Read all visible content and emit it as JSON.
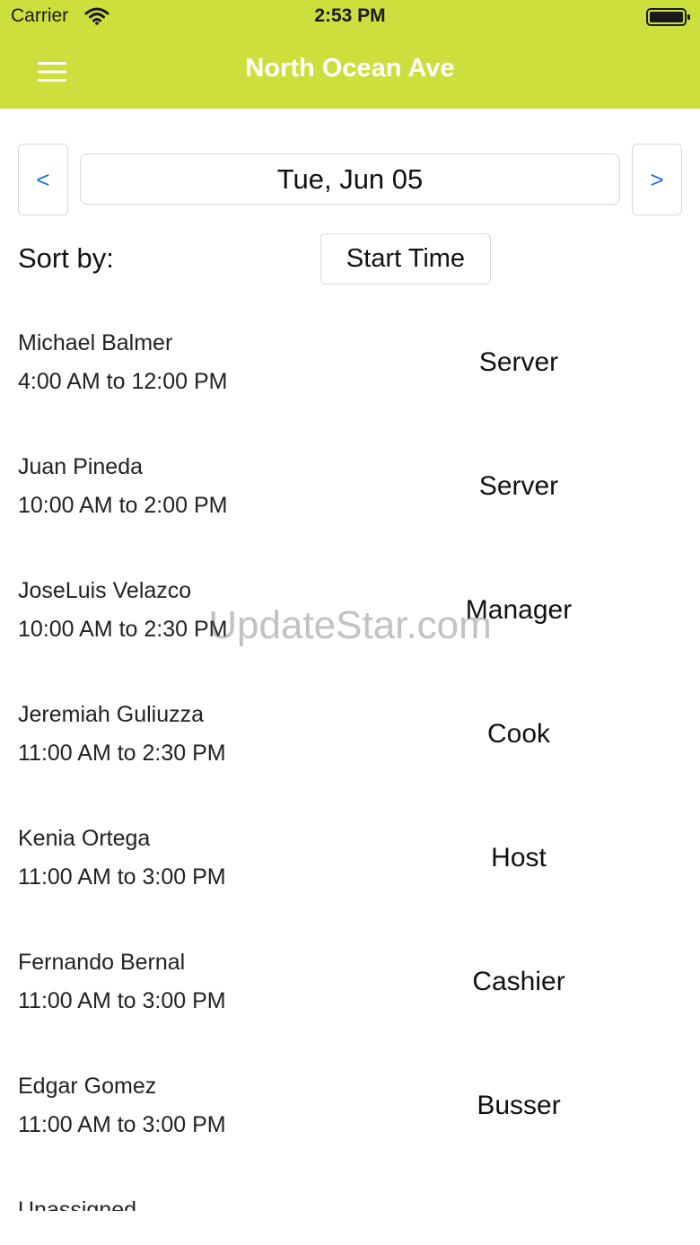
{
  "status_bar": {
    "carrier": "Carrier",
    "time": "2:53 PM",
    "icons": [
      "wifi-icon",
      "battery-icon"
    ]
  },
  "nav": {
    "title": "North Ocean Ave",
    "menu_icon": "menu-icon",
    "bar_color": "#cddf3c"
  },
  "date_nav": {
    "prev_label": "<",
    "next_label": ">",
    "date": "Tue, Jun 05",
    "arrow_color": "#1f6fe0"
  },
  "sort": {
    "label": "Sort by:",
    "value": "Start Time"
  },
  "shifts": [
    {
      "name": "Michael Balmer",
      "time": "4:00 AM to 12:00 PM",
      "role": "Server"
    },
    {
      "name": "Juan Pineda",
      "time": "10:00 AM to 2:00 PM",
      "role": "Server"
    },
    {
      "name": "JoseLuis Velazco",
      "time": "10:00 AM to 2:30 PM",
      "role": "Manager"
    },
    {
      "name": "Jeremiah Guliuzza",
      "time": "11:00 AM to 2:30 PM",
      "role": "Cook"
    },
    {
      "name": "Kenia Ortega",
      "time": "11:00 AM to 3:00 PM",
      "role": "Host"
    },
    {
      "name": "Fernando Bernal",
      "time": "11:00 AM to 3:00 PM",
      "role": "Cashier"
    },
    {
      "name": "Edgar Gomez",
      "time": "11:00 AM to 3:00 PM",
      "role": "Busser"
    },
    {
      "name": "Unassigned",
      "time": "",
      "role": ""
    }
  ],
  "watermark": "UpdateStar.com"
}
